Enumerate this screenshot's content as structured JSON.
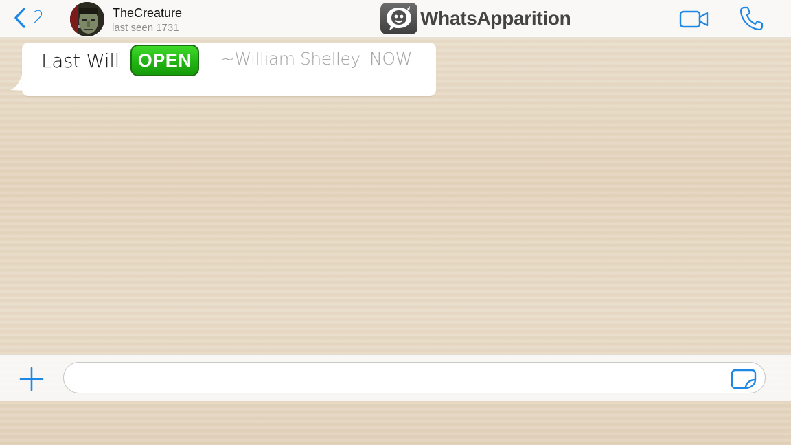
{
  "header": {
    "back_count": "2",
    "contact_name": "TheCreature",
    "contact_status": "last seen 1731",
    "brand_name": "WhatsApparition",
    "icons": {
      "back": "chevron-left-icon",
      "video": "video-camera-icon",
      "phone": "phone-icon",
      "brand": "ghost-chat-logo-icon"
    }
  },
  "messages": [
    {
      "text": "Last Will",
      "button_label": "OPEN",
      "author": "~William Shelley",
      "time": "NOW"
    }
  ],
  "input_bar": {
    "value": "",
    "placeholder": "",
    "icons": {
      "add": "plus-icon",
      "sticker": "sticker-icon"
    }
  },
  "colors": {
    "accent_blue": "#1e88e5",
    "open_button_green": "#22b414",
    "background": "#e6d8c3"
  }
}
